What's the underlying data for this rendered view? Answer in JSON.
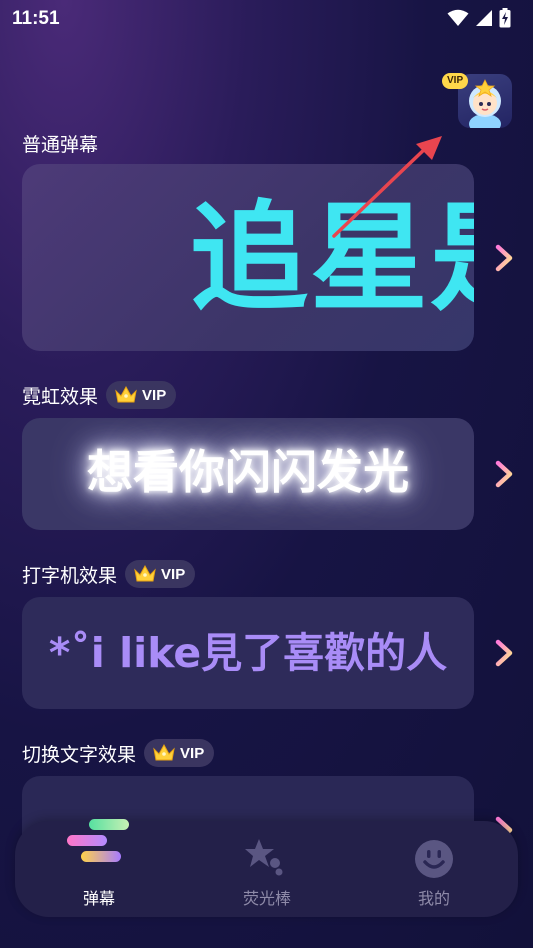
{
  "status_bar": {
    "time": "11:51",
    "icons": [
      "wifi-icon",
      "signal-icon",
      "battery-charging-icon"
    ]
  },
  "profile": {
    "vip_tag": "VIP",
    "avatar": "avatar-star-character"
  },
  "sections": [
    {
      "title": "普通弹幕",
      "preview_text": "追星是",
      "preview_color": "#3fe6f2",
      "vip": false
    },
    {
      "title": "霓虹效果",
      "vip_label": "VIP",
      "preview_text": "想看你闪闪发光",
      "preview_color": "#ffffff",
      "vip": true
    },
    {
      "title": "打字机效果",
      "vip_label": "VIP",
      "preview_text": "*˚i like見了喜歡的人",
      "preview_color": "#a98cf7",
      "vip": true
    },
    {
      "title": "切换文字效果",
      "vip_label": "VIP",
      "preview_text": "",
      "vip": true
    }
  ],
  "tabbar": {
    "tabs": [
      {
        "label": "弹幕",
        "icon": "danmaku-icon",
        "active": true
      },
      {
        "label": "荧光棒",
        "icon": "glow-stick-icon",
        "active": false
      },
      {
        "label": "我的",
        "icon": "smiley-profile-icon",
        "active": false
      }
    ]
  },
  "colors": {
    "accent_cyan": "#3fe6f2",
    "accent_purple": "#a98cf7",
    "vip_gold": "#ffd74a",
    "chevron_gradient": [
      "#ff7ad9",
      "#ffe98a"
    ],
    "annotation_arrow": "#e8454f"
  }
}
